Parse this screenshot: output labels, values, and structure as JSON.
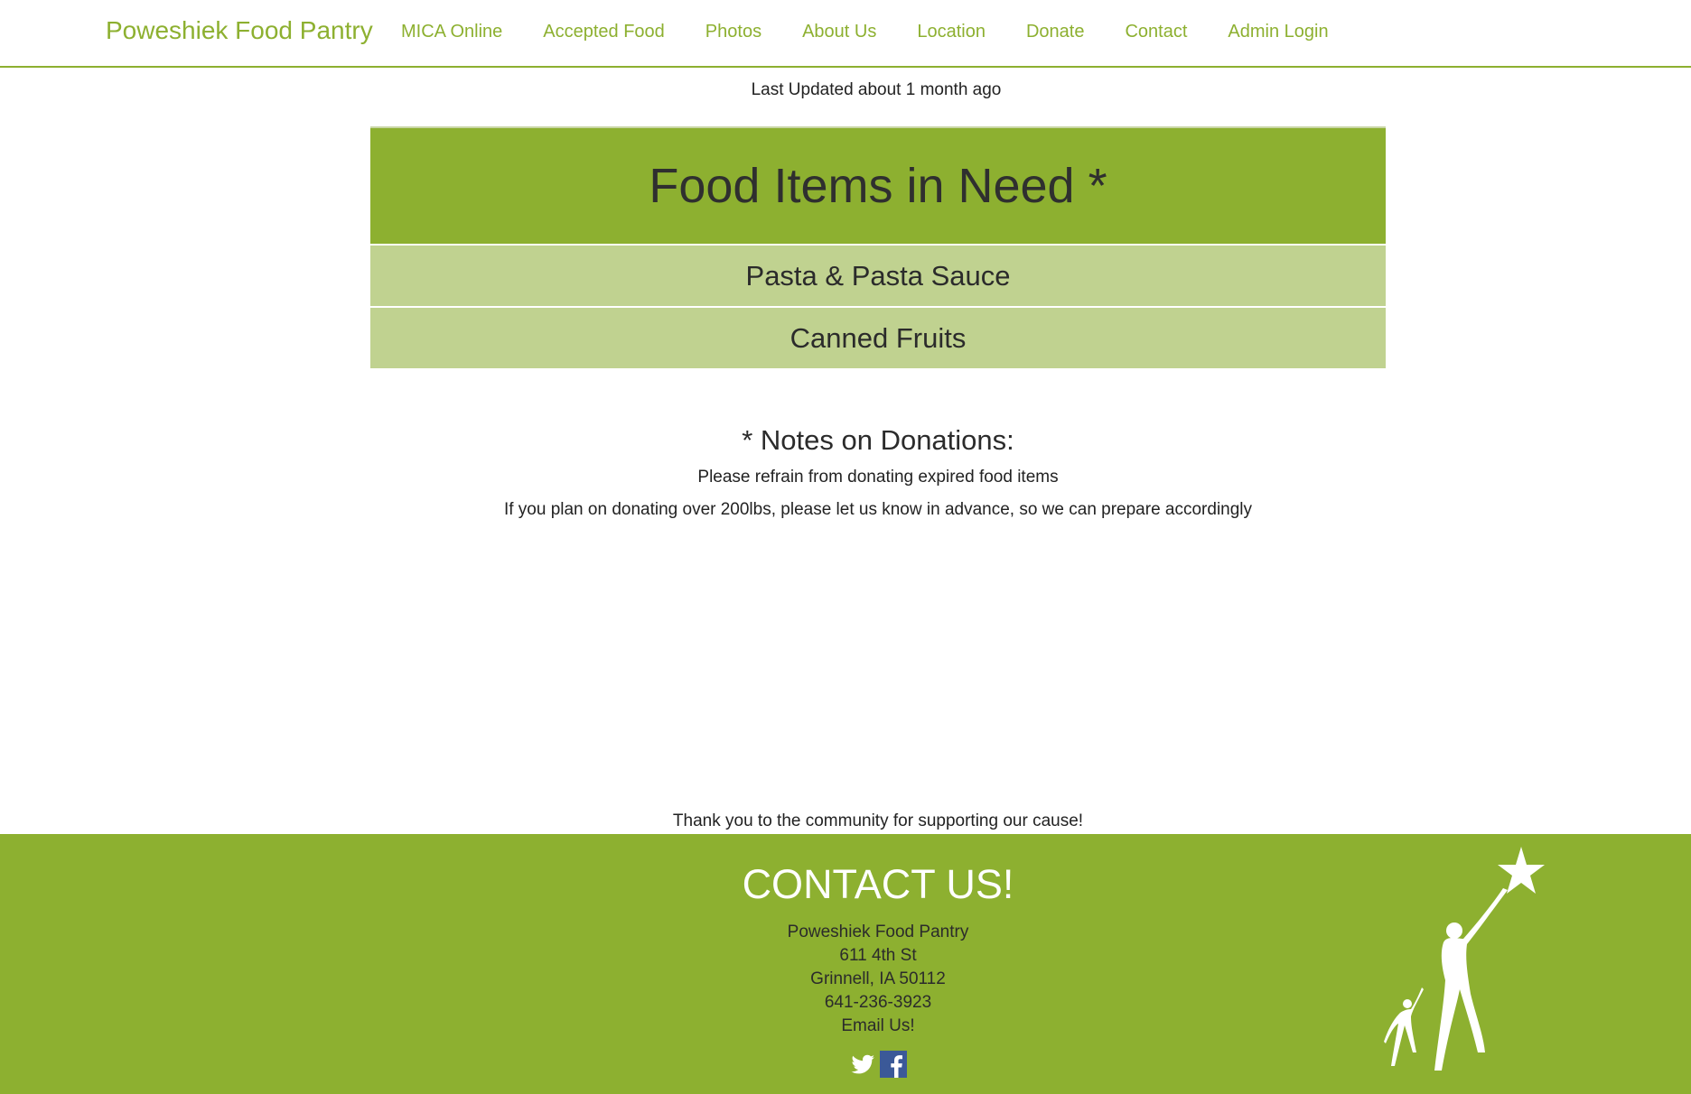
{
  "nav": {
    "brand": "Poweshiek Food Pantry",
    "links": [
      "MICA Online",
      "Accepted Food",
      "Photos",
      "About Us",
      "Location",
      "Donate",
      "Contact",
      "Admin Login"
    ]
  },
  "main": {
    "updated": "Last Updated about 1 month ago",
    "need_title": "Food Items in Need *",
    "need_items": [
      "Pasta & Pasta Sauce",
      "Canned Fruits"
    ],
    "notes_title": "* Notes on Donations:",
    "notes": [
      "Please refrain from donating expired food items",
      "If you plan on donating over 200lbs, please let us know in advance, so we can prepare accordingly"
    ],
    "thanks": "Thank you to the community for supporting our cause!"
  },
  "footer": {
    "title": "CONTACT US!",
    "name": "Poweshiek Food Pantry",
    "street": "611 4th St",
    "city": "Grinnell, IA 50112",
    "phone": "641-236-3923",
    "email_label": "Email Us!",
    "social": [
      "twitter-icon",
      "facebook-icon"
    ]
  },
  "colors": {
    "accent": "#8db030",
    "accent_light": "#c0d290",
    "facebook": "#3b5998",
    "text": "#333333"
  }
}
